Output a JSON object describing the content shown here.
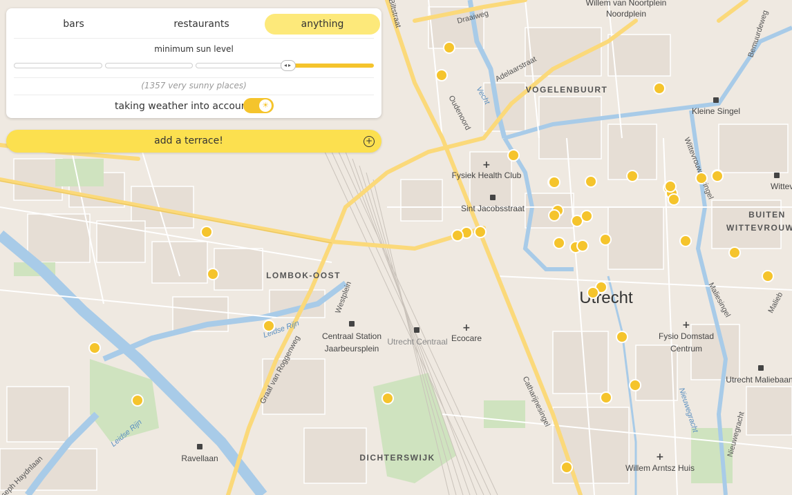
{
  "filter_tabs": [
    {
      "label": "bars",
      "active": false
    },
    {
      "label": "restaurants",
      "active": false
    },
    {
      "label": "anything",
      "active": true
    }
  ],
  "sun_level": {
    "label": "minimum sun level",
    "value_fraction": 0.76
  },
  "count_text": "(1357 very sunny places)",
  "weather": {
    "label": "taking weather into account",
    "enabled": true
  },
  "add_button": {
    "label": "add a terrace!"
  },
  "colors": {
    "accent": "#fce04f",
    "marker": "#f5c42c",
    "water": "#a8cbe8",
    "major_road": "#fbd97a"
  },
  "map": {
    "districts": [
      "VOGELENBUURT",
      "BUITEN",
      "WITTEVROUWEN",
      "LOMBOK-OOST",
      "DICHTERSWIJK"
    ],
    "city": "Utrecht",
    "streets": [
      "Draaiweg",
      "Adelaarstraat",
      "Vecht",
      "Oudenoord",
      "Kleine Singel",
      "Wittevrouwensingel",
      "Leidse Rijn",
      "Westplein",
      "Graaf van Roggenweg",
      "Catharijnesingel",
      "Maliesingel",
      "Nieuwegracht",
      "Joseph Haydnlaan",
      "Biltstraat",
      "Bemuurdeweg",
      "Noordplein",
      "Malieb"
    ],
    "pois": [
      {
        "name": "Fysiek Health Club",
        "icon": "health-cross-icon"
      },
      {
        "name": "Sint Jacobsstraat",
        "icon": "bus-icon"
      },
      {
        "name": "Centraal Station Jaarbeursplein",
        "icon": "bus-icon"
      },
      {
        "name": "Utrecht Centraal",
        "icon": "train-icon"
      },
      {
        "name": "Ecocare",
        "icon": "health-cross-icon"
      },
      {
        "name": "Fysio Domstad Centrum",
        "icon": "health-cross-icon"
      },
      {
        "name": "Utrecht Maliebaan",
        "icon": "train-icon"
      },
      {
        "name": "Willem Arntsz Huis",
        "icon": "health-cross-icon"
      },
      {
        "name": "Ravellaan",
        "icon": "bus-icon"
      },
      {
        "name": "Willem van Noortplein",
        "icon": "none"
      },
      {
        "name": "Wittevrouw",
        "icon": "bus-icon"
      }
    ],
    "terrace_marker_count": 42
  }
}
